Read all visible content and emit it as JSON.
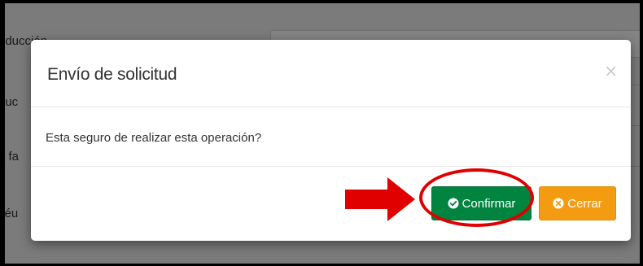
{
  "background": {
    "labels": [
      "oducción",
      "duc",
      "a fa",
      "céu"
    ]
  },
  "modal": {
    "title": "Envío de solicitud",
    "close_symbol": "×",
    "message": "Esta seguro de realizar esta operación?",
    "confirm_label": "Confirmar",
    "close_label": "Cerrar",
    "confirm_icon": "check-circle-icon",
    "close_icon": "times-circle-icon"
  },
  "colors": {
    "confirm_button": "#00843f",
    "close_button": "#f39c12",
    "annotation": "#e00000"
  }
}
